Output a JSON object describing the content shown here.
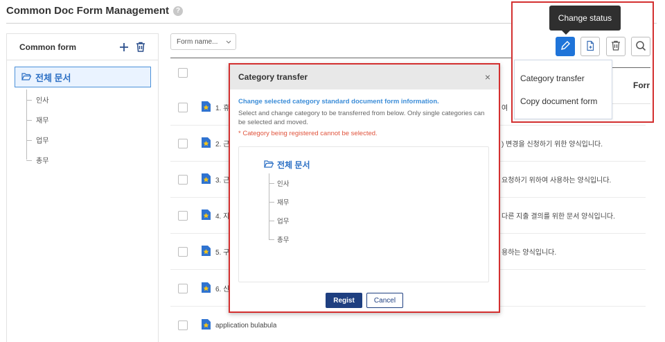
{
  "page": {
    "title": "Common Doc Form Management",
    "help_icon": "?"
  },
  "left_panel": {
    "title": "Common form",
    "add_icon": "plus-icon",
    "delete_icon": "trash-icon",
    "tree": {
      "root": "전체 문서",
      "children": [
        "인사",
        "재무",
        "업무",
        "총무"
      ]
    }
  },
  "main": {
    "filter_select": "Form name...",
    "rows": [
      {
        "prefix": "1. 휴",
        "tail": "여"
      },
      {
        "prefix": "2. 근",
        "tail": ") 변경을 신청하기 위한 양식입니다."
      },
      {
        "prefix": "3. 근",
        "tail": "요청하기 위하여 사용하는 양식입니다."
      },
      {
        "prefix": "4. 지",
        "tail": "다른 지출 결의를 위한 문서 양식입니다."
      },
      {
        "prefix": "5. 구",
        "tail": "용하는 양식입니다."
      },
      {
        "prefix": "6. 신",
        "tail": ""
      },
      {
        "prefix": "application bulabula",
        "tail": ""
      }
    ]
  },
  "toolbar": {
    "tooltip": "Change status",
    "buttons": [
      "pencil-icon",
      "doc-add-icon",
      "trash-icon",
      "search-icon"
    ],
    "dropdown": [
      "Category transfer",
      "Copy document form"
    ],
    "column_header_partial": "Forr"
  },
  "modal": {
    "title": "Category transfer",
    "close": "×",
    "desc_strong": "Change selected category standard document form information.",
    "desc": "Select and change category to be transferred from below. Only single categories can be selected and moved.",
    "warning": "* Category being registered cannot be selected.",
    "tree": {
      "root": "전체 문서",
      "children": [
        "인사",
        "재무",
        "업무",
        "총무"
      ]
    },
    "regist_label": "Regist",
    "cancel_label": "Cancel"
  },
  "colors": {
    "accent": "#1f74d9",
    "highlight": "#d32f2f",
    "primary_button": "#1e3f80",
    "warning_text": "#e0533c",
    "info_text": "#3c8dd8"
  }
}
